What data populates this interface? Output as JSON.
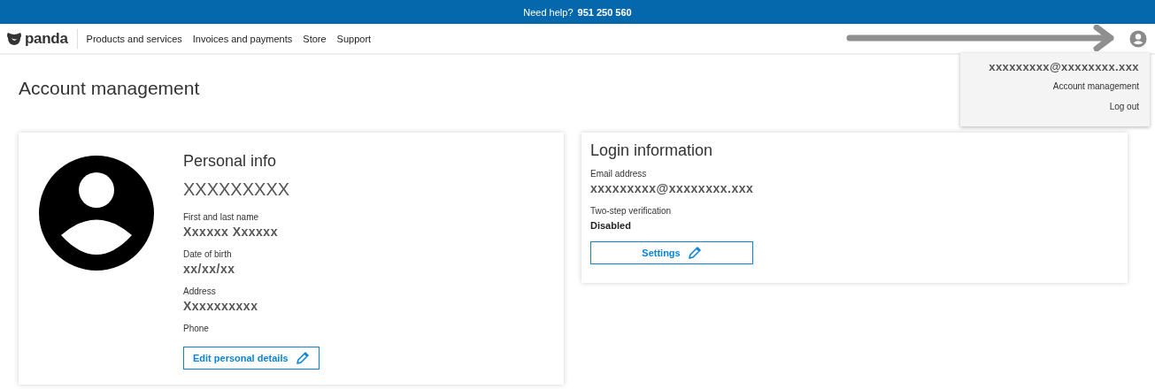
{
  "help_bar": {
    "label": "Need help?",
    "phone": "951 250 560"
  },
  "nav": {
    "logo": "panda",
    "links": [
      "Products and services",
      "Invoices and payments",
      "Store",
      "Support"
    ]
  },
  "user_menu": {
    "email": "xxxxxxxxx@xxxxxxxx.xxx",
    "items": [
      "Account management",
      "Log out"
    ]
  },
  "page_title": "Account management",
  "personal_info": {
    "title": "Personal info",
    "name": "XXXXXXXXX",
    "fields": [
      {
        "label": "First and last name",
        "value": "Xxxxxx Xxxxxx",
        "kind": "value"
      },
      {
        "label": "Date of birth",
        "value": "xx/xx/xx",
        "kind": "value"
      },
      {
        "label": "Address",
        "value": "Xxxxxxxxxx",
        "kind": "value"
      },
      {
        "label": "Phone"
      }
    ],
    "button": "Edit personal details"
  },
  "login_info": {
    "title": "Login information",
    "fields": [
      {
        "label": "Email address",
        "value": "xxxxxxxxx@xxxxxxxx.xxx",
        "kind": "value"
      },
      {
        "label": "Two-step verification",
        "value": "Disabled",
        "kind": "status"
      }
    ],
    "button": "Settings"
  }
}
